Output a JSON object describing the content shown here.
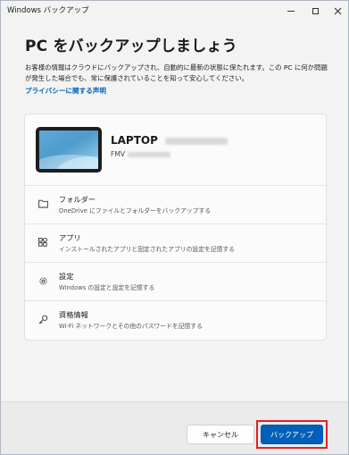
{
  "window": {
    "title": "Windows バックアップ"
  },
  "heading": "PC をバックアップしましょう",
  "description": "お客様の情報はクラウドにバックアップされ、自動的に最新の状態に保たれます。この PC に何か問題が発生した場合でも、常に保護されていることを知って安心してください。",
  "privacy_link": "プライバシーに関する声明",
  "device": {
    "name": "LAPTOP",
    "model": "FMV"
  },
  "items": [
    {
      "icon": "folder-icon",
      "label": "フォルダー",
      "sub": "OneDrive にファイルとフォルダーをバックアップする"
    },
    {
      "icon": "apps-icon",
      "label": "アプリ",
      "sub": "インストールされたアプリと固定されたアプリの設定を記憶する"
    },
    {
      "icon": "gear-icon",
      "label": "設定",
      "sub": "Windows の設定と設定を記憶する"
    },
    {
      "icon": "key-icon",
      "label": "資格情報",
      "sub": "Wi-Fi ネットワークとその他のパスワードを記憶する"
    }
  ],
  "buttons": {
    "cancel": "キャンセル",
    "backup": "バックアップ"
  },
  "colors": {
    "accent": "#005fb8",
    "highlight": "#e0202a",
    "link": "#0062b8"
  }
}
